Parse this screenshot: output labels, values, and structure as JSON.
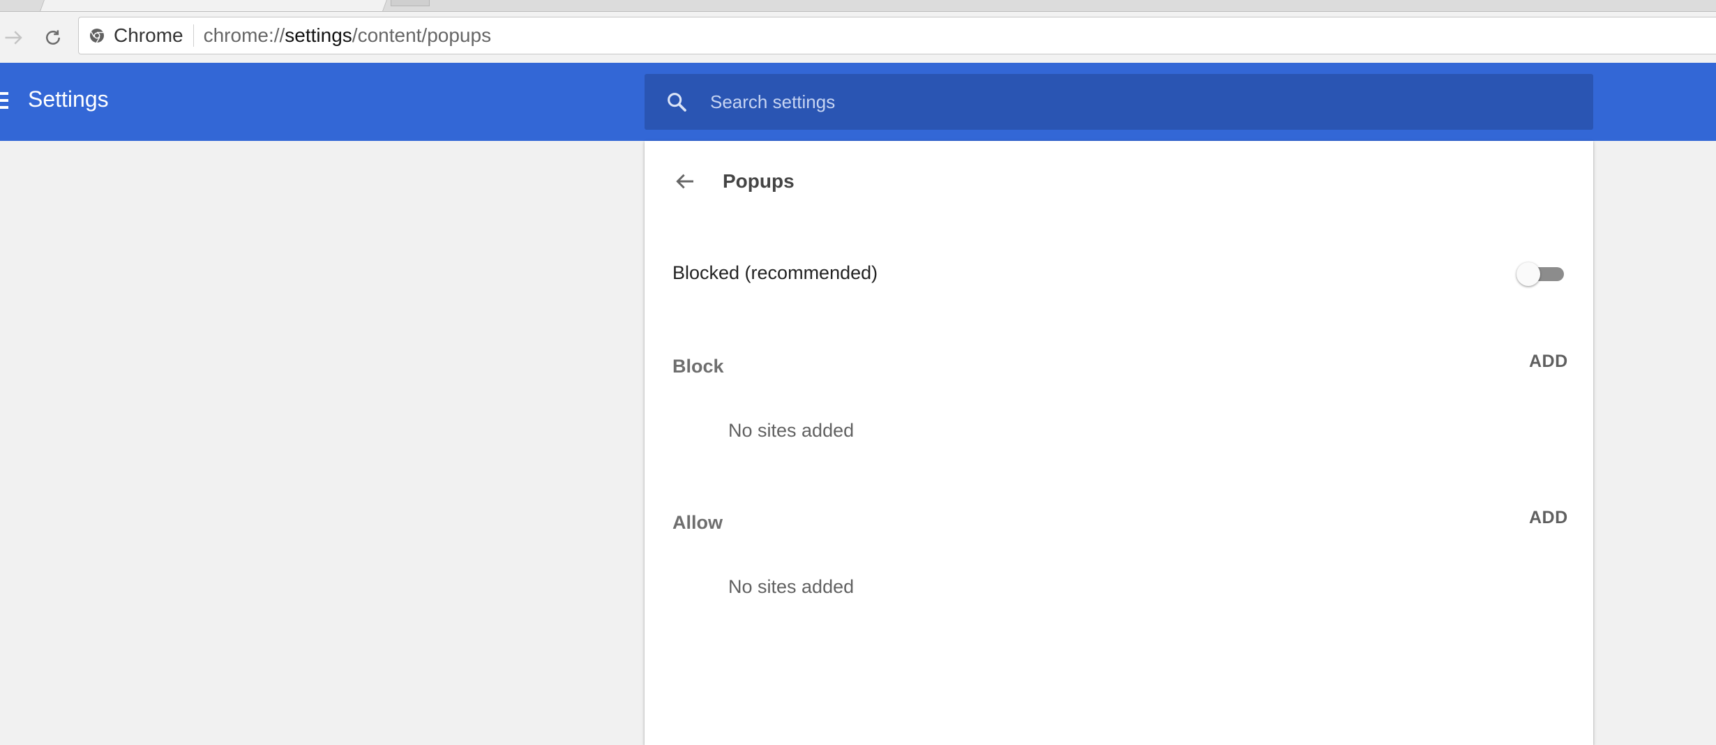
{
  "browser": {
    "chip_label": "Chrome",
    "url_scheme": "chrome://",
    "url_host": "settings",
    "url_path": "/content/popups"
  },
  "appbar": {
    "title": "Settings",
    "search_placeholder": "Search settings",
    "color": "#3367d6"
  },
  "page": {
    "title": "Popups",
    "toggle_label": "Blocked (recommended)",
    "toggle_on": false,
    "sections": [
      {
        "header": "Block",
        "add_label": "ADD",
        "empty_text": "No sites added"
      },
      {
        "header": "Allow",
        "add_label": "ADD",
        "empty_text": "No sites added"
      }
    ]
  }
}
